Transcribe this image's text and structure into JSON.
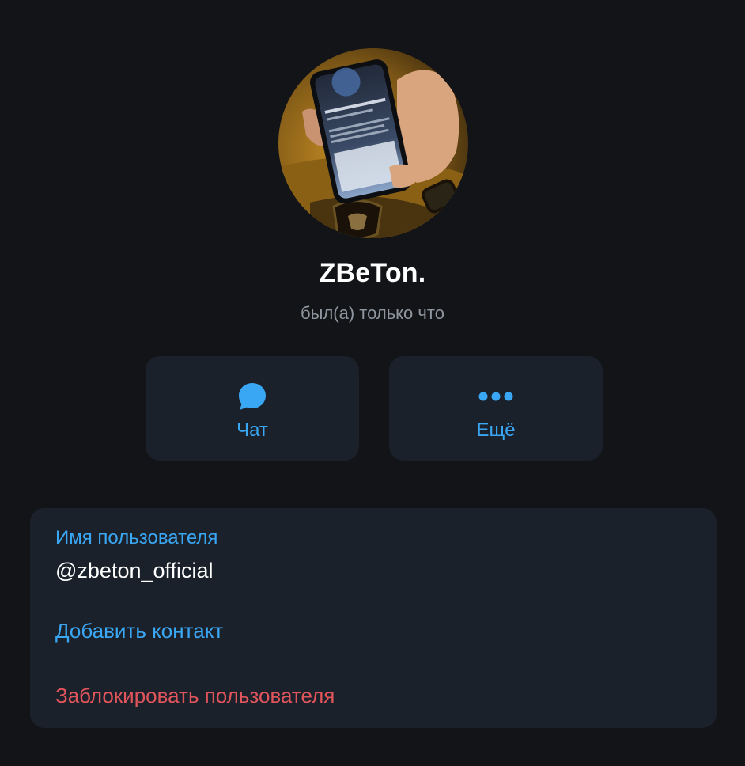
{
  "profile": {
    "name": "ZBeTon.",
    "status": "был(а) только что",
    "avatar_icon": "profile-photo"
  },
  "actions": {
    "chat": {
      "label": "Чат",
      "icon": "chat-bubble-icon"
    },
    "more": {
      "label": "Ещё",
      "icon": "more-dots-icon"
    }
  },
  "info": {
    "username_caption": "Имя пользователя",
    "username_value": "@zbeton_official",
    "add_contact_label": "Добавить контакт",
    "block_user_label": "Заблокировать пользователя"
  },
  "colors": {
    "background": "#131417",
    "card": "#1b212a",
    "accent": "#3aa7f5",
    "danger": "#e0545c",
    "secondary_text": "#8e959e"
  }
}
